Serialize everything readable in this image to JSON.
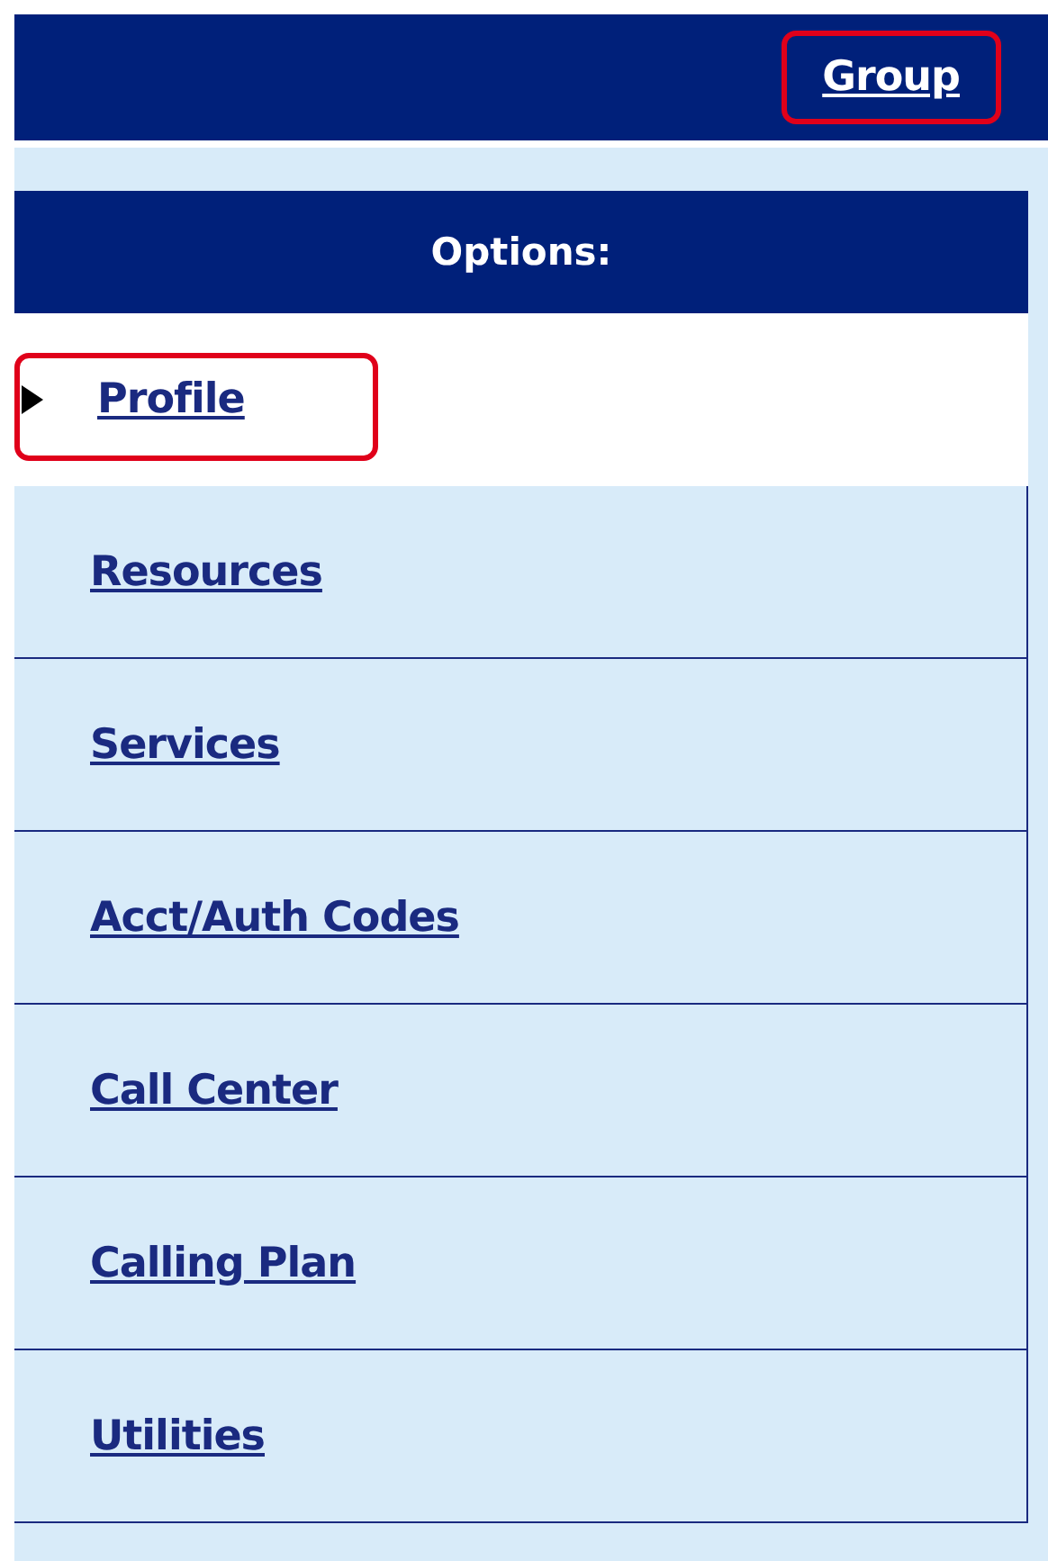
{
  "top_bar": {
    "link": {
      "label": "Group",
      "highlighted": true
    }
  },
  "options": {
    "title": "Options:",
    "items": [
      {
        "label": "Profile",
        "selected": true,
        "highlighted": true
      },
      {
        "label": "Resources",
        "selected": false,
        "highlighted": false
      },
      {
        "label": "Services",
        "selected": false,
        "highlighted": false
      },
      {
        "label": "Acct/Auth Codes",
        "selected": false,
        "highlighted": false
      },
      {
        "label": "Call Center",
        "selected": false,
        "highlighted": false
      },
      {
        "label": "Calling Plan",
        "selected": false,
        "highlighted": false
      },
      {
        "label": "Utilities",
        "selected": false,
        "highlighted": false
      }
    ]
  }
}
